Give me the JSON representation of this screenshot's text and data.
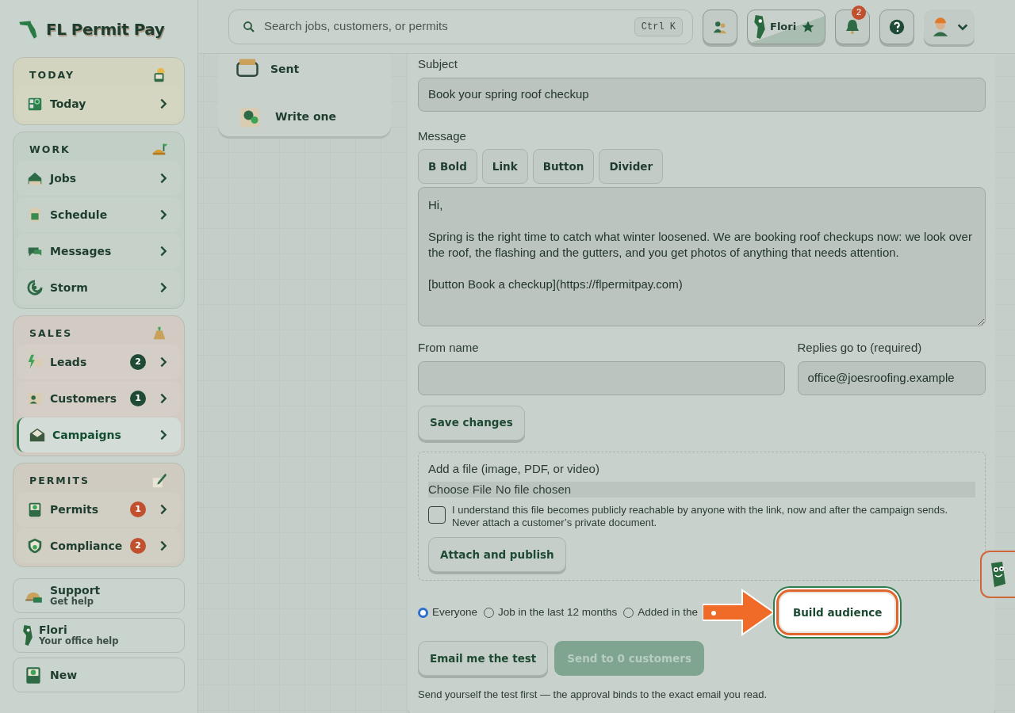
{
  "brand": {
    "name": "FL Permit Pay"
  },
  "sidebar": {
    "groups": [
      {
        "title": "TODAY",
        "color": "#d3d4bf",
        "items": [
          {
            "label": "Today",
            "selected": false
          }
        ]
      },
      {
        "title": "WORK",
        "color": "#c2cfc6",
        "items": [
          {
            "label": "Jobs",
            "selected": false
          },
          {
            "label": "Schedule",
            "selected": false
          },
          {
            "label": "Messages",
            "selected": false
          },
          {
            "label": "Storm",
            "selected": false
          }
        ]
      },
      {
        "title": "SALES",
        "color": "#d2cbc3",
        "items": [
          {
            "label": "Leads",
            "selected": false,
            "badge": {
              "text": "2",
              "color": "#1f4a35"
            }
          },
          {
            "label": "Customers",
            "selected": false,
            "badge": {
              "text": "1",
              "color": "#1f4a35"
            }
          },
          {
            "label": "Campaigns",
            "selected": true
          }
        ]
      },
      {
        "title": "PERMITS",
        "color": "#cfcbc0",
        "items": [
          {
            "label": "Permits",
            "selected": false,
            "badge": {
              "text": "1",
              "color": "#c0502e"
            }
          },
          {
            "label": "Compliance",
            "selected": false,
            "badge": {
              "text": "2",
              "color": "#c0502e"
            }
          }
        ]
      }
    ],
    "footer_items": [
      {
        "title": "Support",
        "subtitle": "Get help"
      },
      {
        "title": "Flori",
        "subtitle": "Your office help"
      },
      {
        "title": "New"
      }
    ]
  },
  "topbar": {
    "search": {
      "placeholder": "Search jobs, customers, or permits",
      "shortcut": "Ctrl K"
    },
    "assistant": {
      "name": "Flori"
    },
    "notifications": {
      "count": "2"
    }
  },
  "left_panel": {
    "items": [
      {
        "label": "Sent"
      },
      {
        "label": "Write one"
      }
    ]
  },
  "form": {
    "subject": {
      "label": "Subject",
      "value": "Book your spring roof checkup"
    },
    "message": {
      "label": "Message",
      "toolbar": [
        {
          "kind": "bold",
          "glyph": "B",
          "label": "Bold"
        },
        {
          "kind": "plain",
          "label": "Link"
        },
        {
          "kind": "plain",
          "label": "Button"
        },
        {
          "kind": "plain",
          "label": "Divider"
        }
      ],
      "value": "Hi,\n\nSpring is the right time to catch what winter loosened. We are booking roof checkups now: we look over the roof, the flashing and the gutters, and you get photos of anything that needs attention.\n\n[button Book a checkup](https://flpermitpay.com)"
    },
    "from_name": {
      "label": "From name"
    },
    "reply_to": {
      "label": "Replies go to (required)",
      "value": "office@joesroofing.example"
    },
    "save_button": "Save changes",
    "attachment": {
      "label": "Add a file (image, PDF, or video)",
      "choose_button": "Choose File",
      "file_status": "No file chosen",
      "consent": {
        "checked": false,
        "text": "I understand this file becomes publicly reachable by anyone with the link, now and after the campaign sends. Never attach a customer’s private document."
      },
      "attach_button": "Attach and publish"
    },
    "audience": [
      {
        "label": "Everyone",
        "selected": true
      },
      {
        "label": "Job in the last 12 months",
        "selected": false
      },
      {
        "label": "Added in the",
        "selected": false
      }
    ],
    "build_button": "Build audience",
    "test_button": {
      "label": "Email me the test",
      "disabled": false
    },
    "send_button": {
      "label": "Send to 0 customers",
      "disabled": true
    },
    "note": "Send yourself the test first — the approval binds to the exact email you read."
  }
}
